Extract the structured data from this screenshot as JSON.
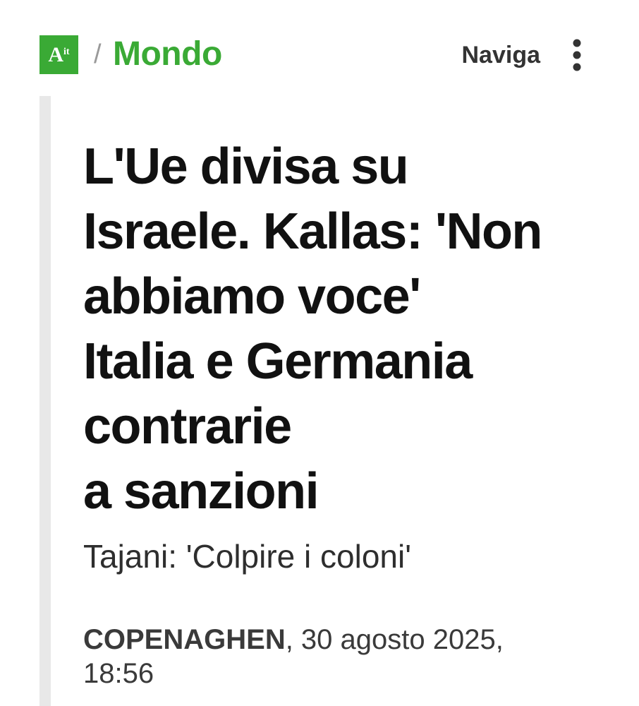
{
  "header": {
    "logo_text": "A",
    "logo_suffix": "it",
    "separator": "/",
    "section": "Mondo",
    "nav_label": "Naviga",
    "menu_icon": "more-vertical-icon",
    "accent_color": "#3aaa35"
  },
  "article": {
    "headline_lines": [
      "L'Ue divisa su",
      "Israele. Kallas: 'Non",
      "abbiamo voce'",
      "Italia e Germania",
      "contrarie",
      "a sanzioni"
    ],
    "subtitle": "Tajani: 'Colpire i coloni'",
    "dateline": {
      "city": "COPENAGHEN",
      "date": ", 30 agosto 2025,",
      "time": "18:56"
    }
  }
}
